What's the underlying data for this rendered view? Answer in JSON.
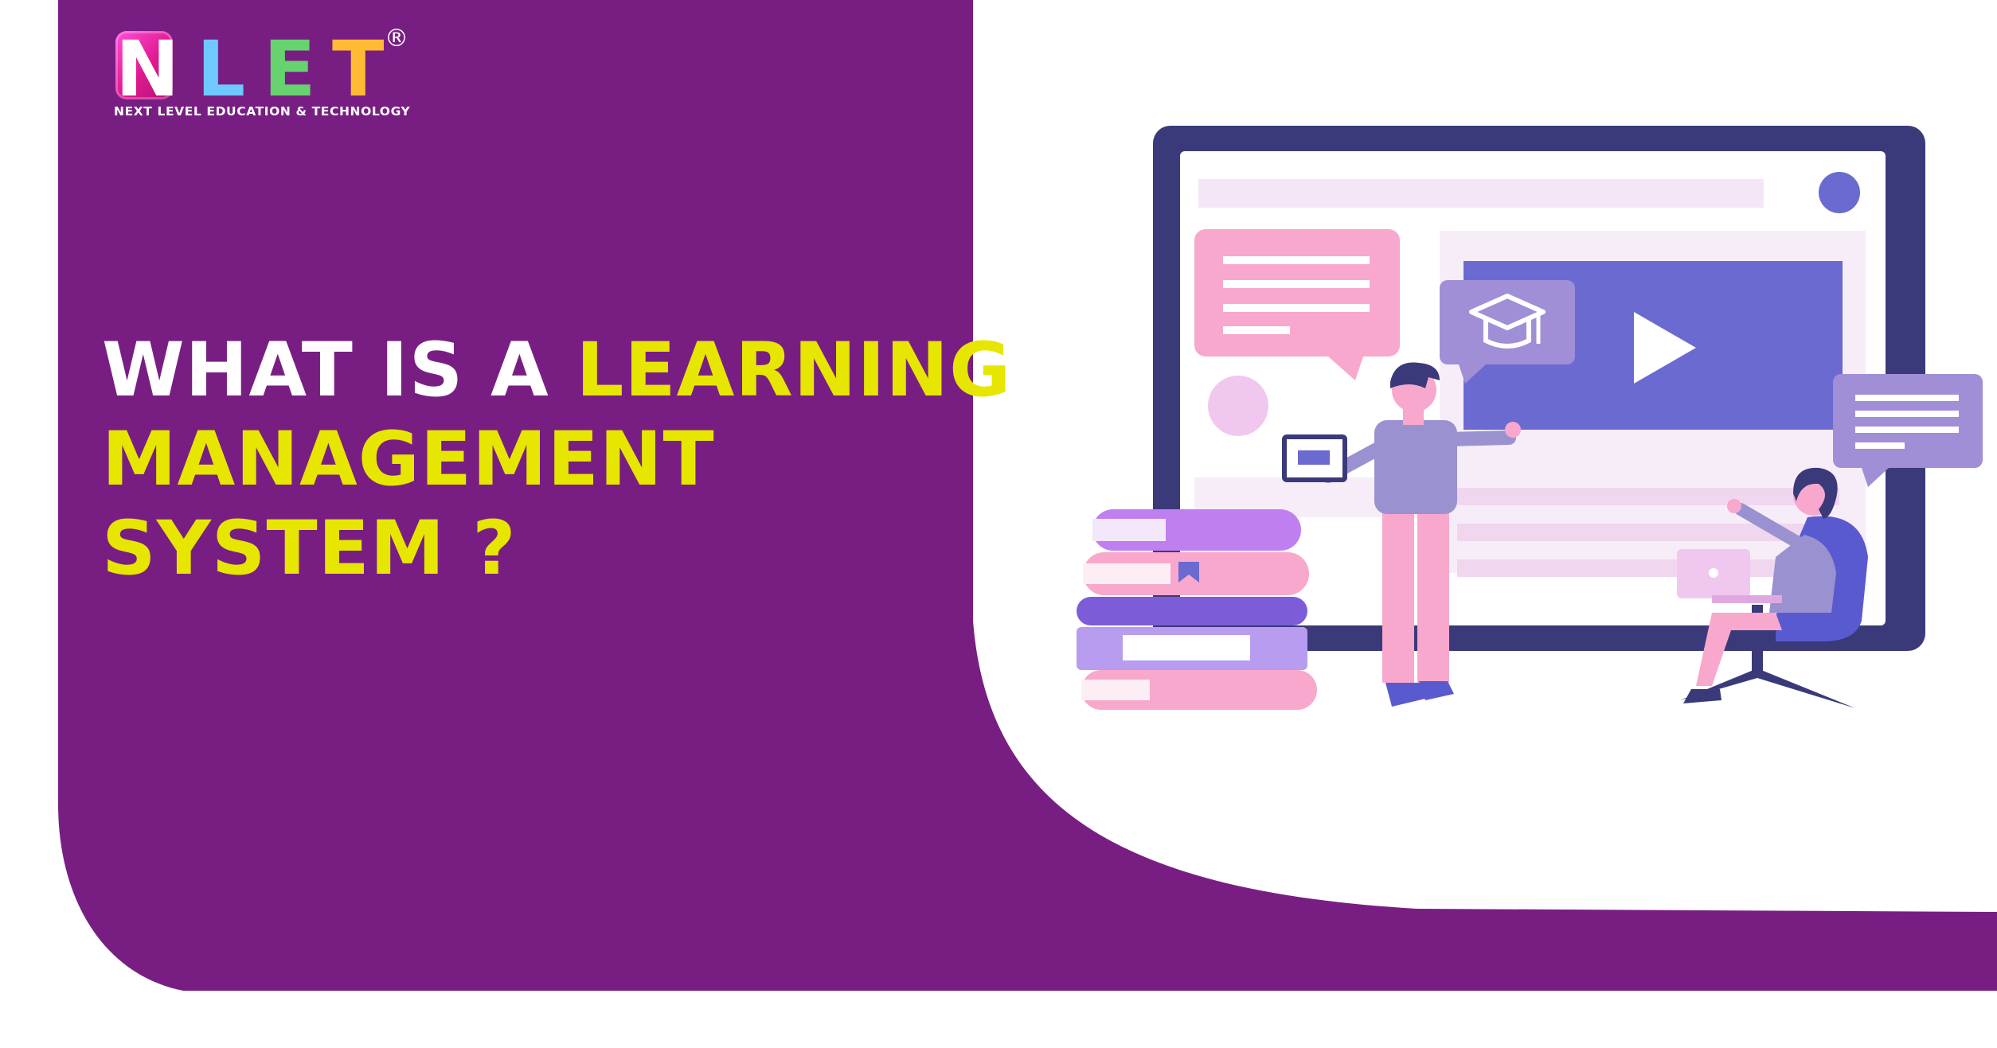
{
  "colors": {
    "background_purple": "#781e83",
    "headline_white": "#ffffff",
    "headline_yellow": "#e6e600",
    "monitor_frame": "#3a3a7a",
    "video_panel": "#6a6ad0"
  },
  "logo": {
    "letter_n": "N",
    "letter_l": "L",
    "letter_e": "E",
    "letter_t": "T",
    "registered_mark": "®",
    "tagline": "NEXT LEVEL EDUCATION & TECHNOLOGY"
  },
  "headline": {
    "line1_white": "WHAT IS A ",
    "line1_yellow": "LEARNING",
    "line2": "MANAGEMENT",
    "line3": "SYSTEM ?"
  },
  "illustration": {
    "icons": [
      "monitor-icon",
      "play-icon",
      "graduation-cap-icon",
      "chat-bubble-icon",
      "books-stack-icon",
      "bookmark-icon",
      "laptop-icon",
      "tablet-icon"
    ]
  }
}
